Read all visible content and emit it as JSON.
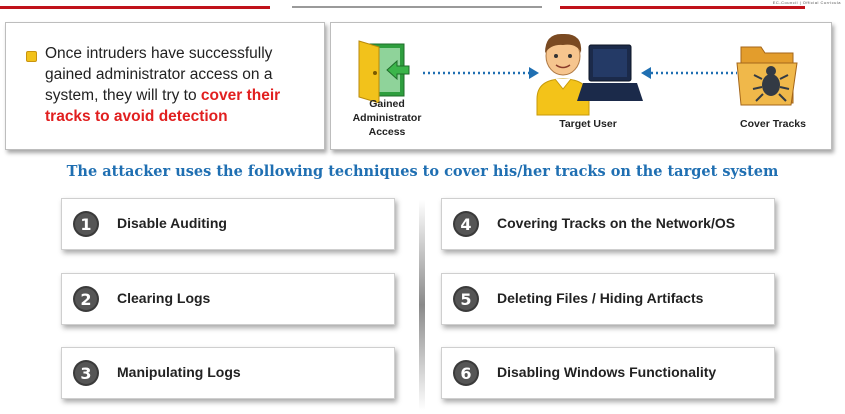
{
  "header": {
    "logo_text": "EC-Council | Official Curricula"
  },
  "intro": {
    "text_plain": "Once intruders have successfully gained administrator access on a system, they will try to ",
    "text_highlight": "cover their tracks to avoid detection"
  },
  "diagram": {
    "admin_label_line1": "Gained",
    "admin_label_line2": "Administrator",
    "admin_label_line3": "Access",
    "target_label": "Target User",
    "cover_label": "Cover Tracks",
    "colors": {
      "arrow": "#1f6fb2",
      "door": "#f2c21b",
      "shirt": "#f3c319"
    }
  },
  "heading": "The attacker uses the following techniques to cover his/her tracks on the target system",
  "techniques": [
    {
      "number": "1",
      "label": "Disable Auditing",
      "icon": "number-1-icon"
    },
    {
      "number": "2",
      "label": "Clearing Logs",
      "icon": "number-2-icon"
    },
    {
      "number": "3",
      "label": "Manipulating Logs",
      "icon": "number-3-icon"
    },
    {
      "number": "4",
      "label": "Covering Tracks on the Network/OS",
      "icon": "number-4-icon"
    },
    {
      "number": "5",
      "label": "Deleting Files / Hiding Artifacts",
      "icon": "number-5-icon"
    },
    {
      "number": "6",
      "label": "Disabling Windows Functionality",
      "icon": "number-6-icon"
    }
  ],
  "colors": {
    "accent_red": "#c0121a",
    "heading_blue": "#1f6fb2",
    "highlight_red": "#e11f1f"
  }
}
